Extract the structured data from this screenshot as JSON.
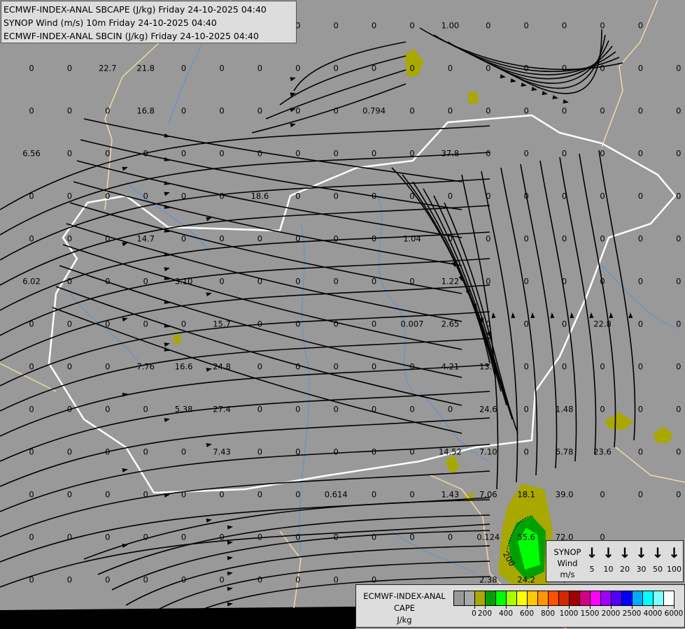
{
  "header": {
    "lines": [
      "ECMWF-INDEX-ANAL SBCAPE (J/kg) Friday 24-10-2025 04:40",
      "SYNOP Wind (m/s) 10m Friday 24-10-2025 04:40",
      "ECMWF-INDEX-ANAL SBCIN (J/kg) Friday 24-10-2025 04:40"
    ]
  },
  "map": {
    "value_grid": [
      [
        "",
        "",
        "",
        "",
        "",
        "",
        "",
        "0",
        "0",
        "0",
        "0",
        "1.00",
        "0",
        "0",
        "0",
        "0",
        "0",
        ""
      ],
      [
        "0",
        "0",
        "22.7",
        "21.8",
        "0",
        "0",
        "0",
        "0",
        "0",
        "0",
        "0",
        "0",
        "0",
        "0",
        "0",
        "0",
        "0",
        "0"
      ],
      [
        "0",
        "0",
        "0",
        "16.8",
        "0",
        "0",
        "0",
        "0",
        "0",
        "0.794",
        "0",
        "0",
        "0",
        "0",
        "0",
        "0",
        "0",
        "0"
      ],
      [
        "6.56",
        "0",
        "0",
        "0",
        "0",
        "0",
        "0",
        "0",
        "0",
        "0",
        "0",
        "37.8",
        "0",
        "0",
        "0",
        "0",
        "0",
        "0"
      ],
      [
        "0",
        "0",
        "0",
        "0",
        "0",
        "0",
        "18.6",
        "0",
        "0",
        "0",
        "0",
        "0",
        "0",
        "0",
        "0",
        "0",
        "0",
        "0"
      ],
      [
        "0",
        "0",
        "0",
        "14.7",
        "0",
        "0",
        "0",
        "0",
        "0",
        "0",
        "1.04",
        "0",
        "0",
        "0",
        "0",
        "0",
        "0",
        "0"
      ],
      [
        "6.02",
        "0",
        "0",
        "0",
        "3.10",
        "0",
        "0",
        "0",
        "0",
        "0",
        "0",
        "1.22",
        "0",
        "0",
        "0",
        "0",
        "0",
        "0"
      ],
      [
        "0",
        "0",
        "0",
        "0",
        "0",
        "15.7",
        "0",
        "0",
        "0",
        "0",
        "0.007",
        "2.65",
        "0",
        "0",
        "0",
        "22.8",
        "0",
        "0"
      ],
      [
        "0",
        "0",
        "0",
        "7.76",
        "16.6",
        "24.8",
        "0",
        "0",
        "0",
        "0",
        "0",
        "4.21",
        "13.7",
        "0",
        "0",
        "0",
        "0",
        "0"
      ],
      [
        "0",
        "0",
        "0",
        "0",
        "5.38",
        "27.4",
        "0",
        "0",
        "0",
        "0",
        "0",
        "0",
        "24.6",
        "0",
        "1.48",
        "0",
        "0",
        "0"
      ],
      [
        "0",
        "0",
        "0",
        "0",
        "0",
        "7.43",
        "0",
        "0",
        "0",
        "0",
        "0",
        "14.52",
        "7.10",
        "0",
        "6.78",
        "23.6",
        "0",
        "0"
      ],
      [
        "0",
        "0",
        "0",
        "0",
        "0",
        "0",
        "0",
        "0",
        "0.614",
        "0",
        "0",
        "1.43",
        "7.06",
        "18.1",
        "39.0",
        "0",
        "0",
        "0"
      ],
      [
        "0",
        "0",
        "0",
        "0",
        "0",
        "0",
        "0",
        "0",
        "0",
        "0",
        "0",
        "0",
        "0.124",
        "55.6",
        "72.0",
        "0",
        "",
        ""
      ],
      [
        "0",
        "0",
        "0",
        "0",
        "0",
        "0",
        "0",
        "0",
        "0",
        "0",
        "",
        "",
        "2.38",
        "24.2",
        "0",
        "",
        "",
        ""
      ]
    ],
    "cin_contour_label": "200",
    "colors": {
      "background": "#999999",
      "streamline": "#000000",
      "border_country": "#ffffff",
      "border_region": "#f0d8a8",
      "river": "#4a90e0"
    }
  },
  "synop_legend": {
    "label_lines": [
      "SYNOP",
      "Wind",
      "m/s"
    ],
    "speeds": [
      "5",
      "10",
      "20",
      "30",
      "50",
      "100"
    ],
    "arrow_icon": "arrow-down-icon"
  },
  "cape_legend": {
    "title_lines": [
      "ECMWF-INDEX-ANAL",
      "CAPE",
      "J/kg"
    ],
    "colors": [
      "#999999",
      "#a8a8a8",
      "#a8a800",
      "#00a000",
      "#00ff00",
      "#a8ff00",
      "#ffff00",
      "#ffc800",
      "#ff9600",
      "#ff5000",
      "#d22800",
      "#a00000",
      "#d20082",
      "#ff00ff",
      "#a000ff",
      "#5000ff",
      "#0000ff",
      "#00aaff",
      "#00ffff",
      "#80ffff",
      "#ffffff"
    ],
    "tick_labels": [
      "0",
      "200",
      "400",
      "600",
      "800",
      "1000",
      "1500",
      "2000",
      "2500",
      "4000",
      "6000"
    ]
  }
}
